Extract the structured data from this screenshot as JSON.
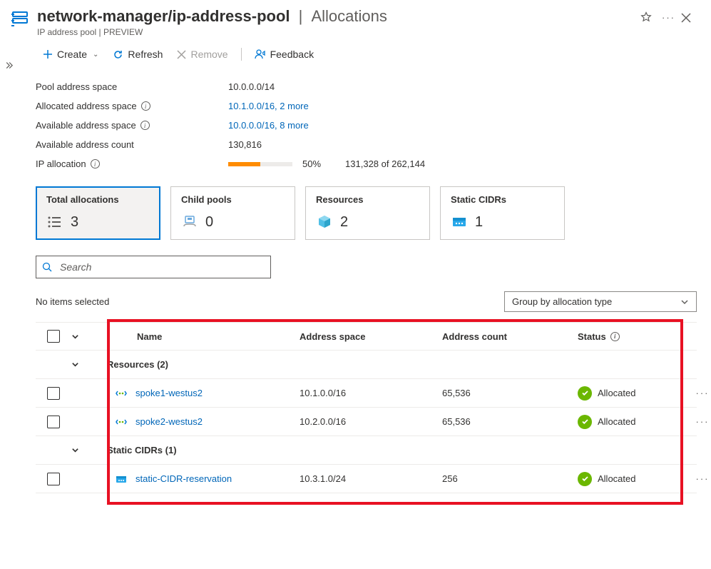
{
  "header": {
    "breadcrumb": "network-manager/ip-address-pool",
    "section": "Allocations",
    "subtitle": "IP address pool | PREVIEW"
  },
  "toolbar": {
    "create": "Create",
    "refresh": "Refresh",
    "remove": "Remove",
    "feedback": "Feedback"
  },
  "props": {
    "pool_space_label": "Pool address space",
    "pool_space_value": "10.0.0.0/14",
    "allocated_space_label": "Allocated address space",
    "allocated_space_value": "10.1.0.0/16, 2 more",
    "available_space_label": "Available address space",
    "available_space_value": "10.0.0.0/16, 8 more",
    "available_count_label": "Available address count",
    "available_count_value": "130,816",
    "ip_alloc_label": "IP allocation",
    "ip_alloc_percent": "50%",
    "ip_alloc_detail": "131,328 of 262,144"
  },
  "cards": {
    "total": {
      "title": "Total allocations",
      "count": "3"
    },
    "child": {
      "title": "Child pools",
      "count": "0"
    },
    "resources": {
      "title": "Resources",
      "count": "2"
    },
    "static": {
      "title": "Static CIDRs",
      "count": "1"
    }
  },
  "search": {
    "placeholder": "Search"
  },
  "listbar": {
    "no_items": "No items selected",
    "group_by": "Group by allocation type"
  },
  "columns": {
    "name": "Name",
    "space": "Address space",
    "count": "Address count",
    "status": "Status"
  },
  "groups": {
    "resources": "Resources (2)",
    "static": "Static CIDRs (1)"
  },
  "rows": {
    "r1": {
      "name": "spoke1-westus2",
      "space": "10.1.0.0/16",
      "count": "65,536",
      "status": "Allocated"
    },
    "r2": {
      "name": "spoke2-westus2",
      "space": "10.2.0.0/16",
      "count": "65,536",
      "status": "Allocated"
    },
    "r3": {
      "name": "static-CIDR-reservation",
      "space": "10.3.1.0/24",
      "count": "256",
      "status": "Allocated"
    }
  }
}
